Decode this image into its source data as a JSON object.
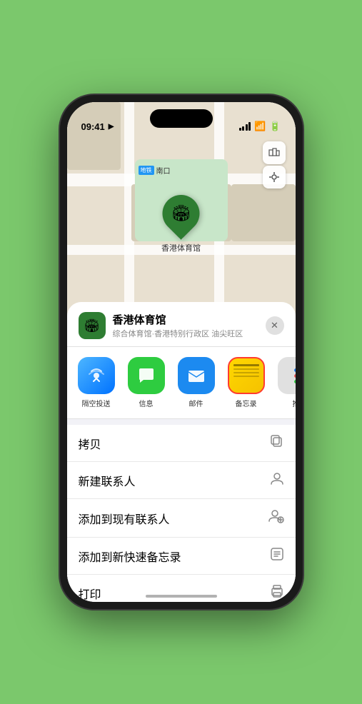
{
  "statusBar": {
    "time": "09:41",
    "navArrow": "▶"
  },
  "map": {
    "stationBadge": "地铁",
    "stationLabel": "南口",
    "markerLabel": "香港体育馆",
    "markerEmoji": "🏟"
  },
  "sheet": {
    "venueName": "香港体育馆",
    "venueSubtitle": "综合体育馆·香港特别行政区 油尖旺区",
    "venueEmoji": "🏟",
    "closeLabel": "✕"
  },
  "shareItems": [
    {
      "label": "隔空投送",
      "type": "airdrop",
      "icon": "📡"
    },
    {
      "label": "信息",
      "type": "messages",
      "icon": "💬"
    },
    {
      "label": "邮件",
      "type": "mail",
      "icon": "✉️"
    },
    {
      "label": "备忘录",
      "type": "notes",
      "icon": ""
    },
    {
      "label": "推",
      "type": "more",
      "icon": ""
    }
  ],
  "actions": [
    {
      "label": "拷贝",
      "icon": "⎘"
    },
    {
      "label": "新建联系人",
      "icon": "👤"
    },
    {
      "label": "添加到现有联系人",
      "icon": "👤"
    },
    {
      "label": "添加到新快速备忘录",
      "icon": "⊞"
    },
    {
      "label": "打印",
      "icon": "🖨"
    }
  ],
  "colors": {
    "accent": "#2e7d32",
    "notesSelected": "#ff3b30"
  }
}
